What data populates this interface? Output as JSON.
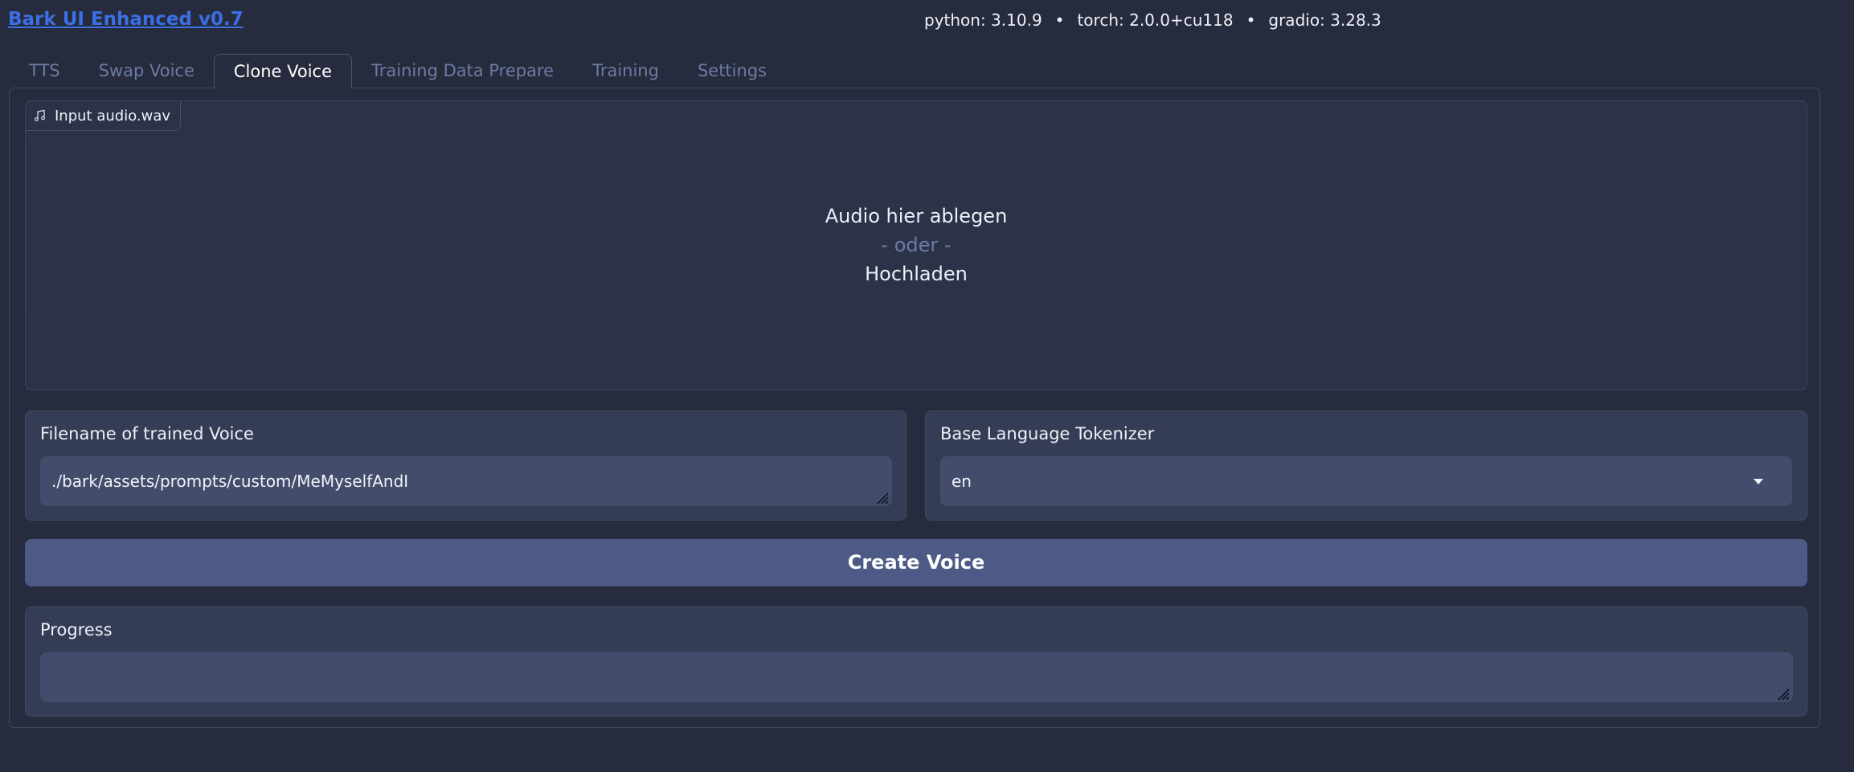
{
  "header": {
    "app_title": "Bark UI Enhanced v0.7",
    "versions": [
      "python: 3.10.9",
      "torch: 2.0.0+cu118",
      "gradio: 3.28.3"
    ],
    "separator": "•"
  },
  "tabs": [
    {
      "label": "TTS",
      "active": false
    },
    {
      "label": "Swap Voice",
      "active": false
    },
    {
      "label": "Clone Voice",
      "active": true
    },
    {
      "label": "Training Data Prepare",
      "active": false
    },
    {
      "label": "Training",
      "active": false
    },
    {
      "label": "Settings",
      "active": false
    }
  ],
  "audio_input": {
    "label": "Input audio.wav",
    "icon": "music-note-icon",
    "drop_text": "Audio hier ablegen",
    "or_text": "- oder -",
    "upload_text": "Hochladen"
  },
  "filename_field": {
    "label": "Filename of trained Voice",
    "value": "./bark/assets/prompts/custom/MeMyselfAndI"
  },
  "tokenizer_field": {
    "label": "Base Language Tokenizer",
    "value": "en"
  },
  "create_button": {
    "label": "Create Voice"
  },
  "progress_field": {
    "label": "Progress",
    "value": ""
  },
  "colors": {
    "background": "#262c3d",
    "title_link": "#3b6fe6",
    "primary_button": "#4c5a85",
    "input_bg": "#434c6b"
  }
}
